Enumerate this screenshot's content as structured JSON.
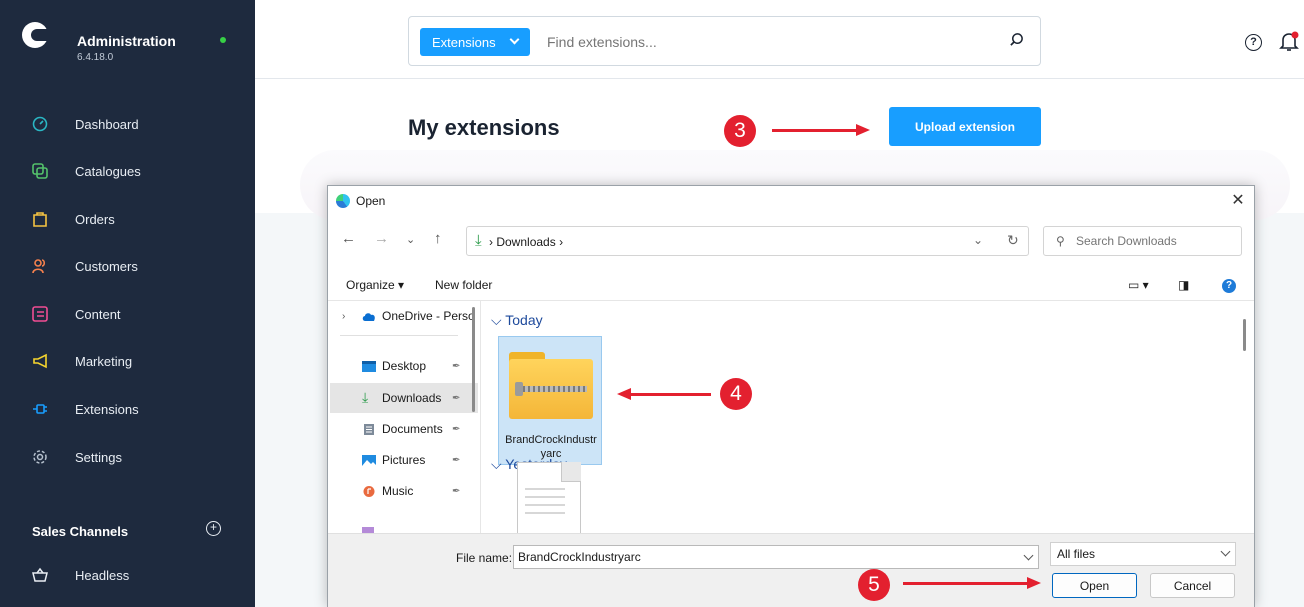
{
  "app": {
    "title": "Administration",
    "version": "6.4.18.0",
    "status_color": "#37d046"
  },
  "sidebar": {
    "items": [
      {
        "label": "Dashboard",
        "icon": "dashboard-icon",
        "color": "#2ab7c4"
      },
      {
        "label": "Catalogues",
        "icon": "catalogue-icon",
        "color": "#54c26b"
      },
      {
        "label": "Orders",
        "icon": "orders-icon",
        "color": "#f5c342"
      },
      {
        "label": "Customers",
        "icon": "customers-icon",
        "color": "#f5814d"
      },
      {
        "label": "Content",
        "icon": "content-icon",
        "color": "#f04d93"
      },
      {
        "label": "Marketing",
        "icon": "marketing-icon",
        "color": "#f5d42e"
      },
      {
        "label": "Extensions",
        "icon": "extensions-icon",
        "color": "#189eff"
      },
      {
        "label": "Settings",
        "icon": "settings-icon",
        "color": "#b7c2cf"
      }
    ],
    "sales_channels_title": "Sales Channels",
    "sales_channels": [
      {
        "label": "Headless",
        "icon": "basket-icon"
      }
    ]
  },
  "search": {
    "type_label": "Extensions",
    "placeholder": "Find extensions..."
  },
  "main": {
    "title": "My extensions",
    "upload_label": "Upload extension",
    "accent": "#189eff"
  },
  "annotations": {
    "step3": "3",
    "step4": "4",
    "step5": "5",
    "color": "#e3202f"
  },
  "dialog": {
    "title": "Open",
    "address": "Downloads",
    "address_sep": "›",
    "search_placeholder": "Search Downloads",
    "organize": "Organize ▾",
    "new_folder": "New folder",
    "nav": [
      {
        "label": "OneDrive - Perso",
        "icon": "cloud-icon"
      },
      {
        "label": "Desktop",
        "icon": "desktop-icon"
      },
      {
        "label": "Downloads",
        "icon": "download-icon",
        "selected": true
      },
      {
        "label": "Documents",
        "icon": "documents-icon"
      },
      {
        "label": "Pictures",
        "icon": "pictures-icon"
      },
      {
        "label": "Music",
        "icon": "music-icon"
      }
    ],
    "groups": {
      "today": "Today",
      "yesterday": "Yesterday"
    },
    "file": {
      "name": "BrandCrockIndustryarc"
    },
    "footer": {
      "file_name_label": "File name:",
      "file_name_value": "BrandCrockIndustryarc",
      "file_type": "All files",
      "open": "Open",
      "cancel": "Cancel"
    }
  }
}
